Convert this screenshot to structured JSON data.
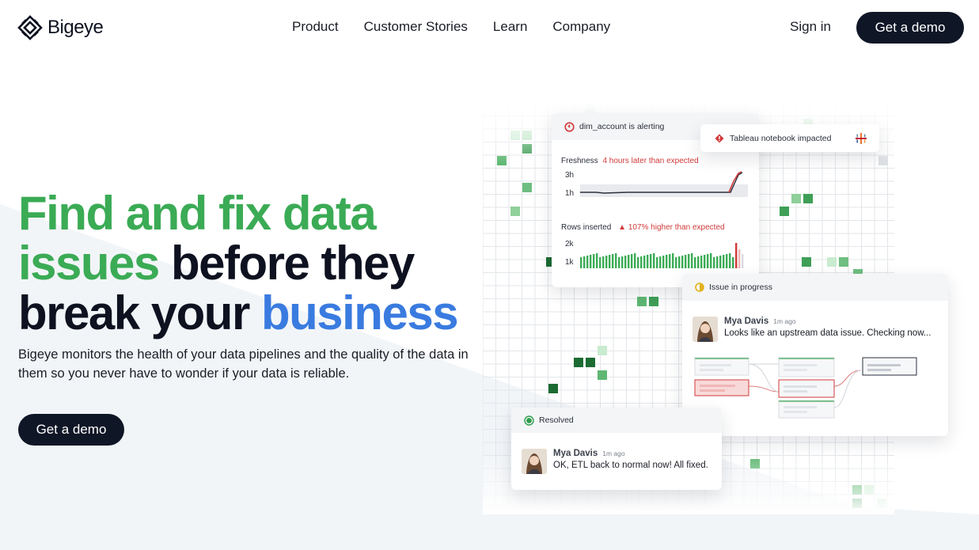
{
  "brand": {
    "name": "Bigeye"
  },
  "nav": {
    "links": [
      "Product",
      "Customer Stories",
      "Learn",
      "Company"
    ],
    "sign_in": "Sign in",
    "cta": "Get a demo"
  },
  "hero": {
    "line1": "Find and fix data",
    "line2_green": "issues",
    "line2_dark": " before they",
    "line3_dark": "break your ",
    "line3_blue": "business",
    "subtitle": "Bigeye monitors the health of your data pipelines and the quality of the data in them so you never have to wonder if your data is reliable.",
    "cta": "Get a demo"
  },
  "colors": {
    "green": "#3bab55",
    "blue": "#3a7be0",
    "dark": "#0f1626",
    "alert_red": "#d13a3a"
  },
  "alert_card": {
    "title": "dim_account is alerting",
    "freshness_label": "Freshness",
    "freshness_note": "4 hours later than expected",
    "freshness_ticks": [
      "3h",
      "1h"
    ],
    "rows_label": "Rows inserted",
    "rows_note": "107% higher than expected",
    "rows_ticks": [
      "2k",
      "1k"
    ]
  },
  "tableau_card": {
    "text": "Tableau notebook impacted"
  },
  "issue_card": {
    "status": "Issue in progress",
    "author": "Mya Davis",
    "time": "1m ago",
    "message": "Looks like an upstream data issue. Checking now..."
  },
  "resolved_card": {
    "status": "Resolved",
    "author": "Mya Davis",
    "time": "1m ago",
    "message": "OK, ETL back to normal now! All fixed."
  },
  "icons": [
    "bigeye-logo-icon",
    "alert-clock-icon",
    "warning-diamond-icon",
    "tableau-icon",
    "in-progress-icon",
    "resolved-check-icon",
    "avatar-icon"
  ]
}
